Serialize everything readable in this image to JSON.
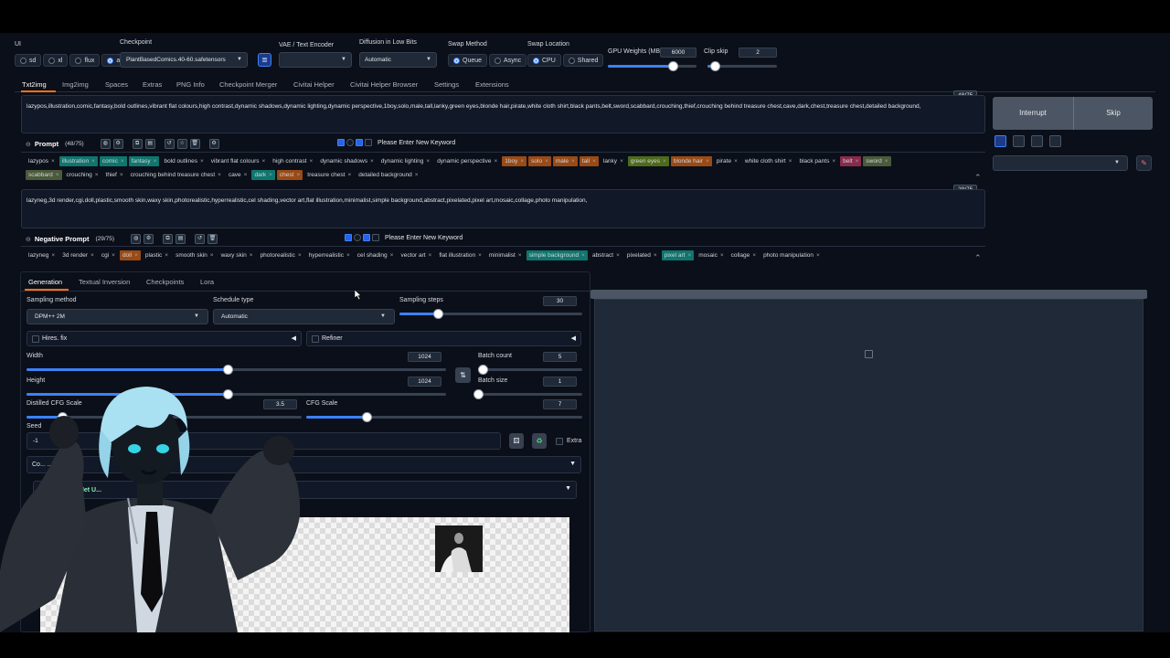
{
  "top": {
    "ui_label": "UI",
    "ui_options": [
      "sd",
      "xl",
      "flux",
      "all"
    ],
    "checkpoint_label": "Checkpoint",
    "checkpoint_value": "PlantBasedComics.40-60.safetensors",
    "vae_label": "VAE / Text Encoder",
    "vae_value": "",
    "lowbits_label": "Diffusion in Low Bits",
    "lowbits_value": "Automatic",
    "swap_method_label": "Swap Method",
    "swap_method_options": [
      "Queue",
      "Async"
    ],
    "swap_location_label": "Swap Location",
    "swap_location_options": [
      "CPU",
      "Shared"
    ],
    "gpu_weights_label": "GPU Weights (MB)",
    "gpu_weights_value": "6000",
    "gpu_weights_fraction": 0.73,
    "clip_skip_label": "Clip skip",
    "clip_skip_value": "2",
    "clip_skip_fraction": 0.1
  },
  "tabs": [
    "Txt2img",
    "Img2img",
    "Spaces",
    "Extras",
    "PNG Info",
    "Checkpoint Merger",
    "Civitai Helper",
    "Civitai Helper Browser",
    "Settings",
    "Extensions"
  ],
  "prompt": {
    "counter": "48/75",
    "text": "lazypos,illustration,comic,fantasy,bold outlines,vibrant flat colours,high contrast,dynamic shadows,dynamic lighting,dynamic perspective,1boy,solo,male,tall,lanky,green eyes,blonde hair,pirate,white cloth shirt,black pants,belt,sword,scabbard,crouching,thief,crouching behind treasure chest,cave,dark,chest,treasure chest,detailed background,",
    "label": "Prompt",
    "label_count": "(48/75)",
    "keyword_placeholder": "Please Enter New Keyword",
    "tags_row1": [
      {
        "t": "lazypos",
        "c": ""
      },
      {
        "t": "illustration",
        "c": "#0f766e"
      },
      {
        "t": "comic",
        "c": "#0f766e"
      },
      {
        "t": "fantasy",
        "c": "#0f766e"
      },
      {
        "t": "bold outlines",
        "c": ""
      },
      {
        "t": "vibrant flat colours",
        "c": ""
      },
      {
        "t": "high contrast",
        "c": ""
      },
      {
        "t": "dynamic shadows",
        "c": ""
      },
      {
        "t": "dynamic lighting",
        "c": ""
      },
      {
        "t": "dynamic perspective",
        "c": ""
      },
      {
        "t": "1boy",
        "c": "#9a4a15"
      },
      {
        "t": "solo",
        "c": "#9a4a15"
      },
      {
        "t": "male",
        "c": "#9a4a15"
      },
      {
        "t": "tall",
        "c": "#9a4a15"
      },
      {
        "t": "lanky",
        "c": ""
      },
      {
        "t": "green eyes",
        "c": "#4d6b1a"
      },
      {
        "t": "blonde hair",
        "c": "#9a4a15"
      },
      {
        "t": "pirate",
        "c": ""
      },
      {
        "t": "white cloth shirt",
        "c": ""
      },
      {
        "t": "black pants",
        "c": ""
      },
      {
        "t": "belt",
        "c": "#8a2a4a"
      },
      {
        "t": "sword",
        "c": "#4a5a3a"
      }
    ],
    "tags_row2": [
      {
        "t": "scabbard",
        "c": "#4a5a3a"
      },
      {
        "t": "crouching",
        "c": ""
      },
      {
        "t": "thief",
        "c": ""
      },
      {
        "t": "crouching behind treasure chest",
        "c": ""
      },
      {
        "t": "cave",
        "c": ""
      },
      {
        "t": "dark",
        "c": "#0f766e"
      },
      {
        "t": "chest",
        "c": "#9a4a15"
      },
      {
        "t": "treasure chest",
        "c": ""
      },
      {
        "t": "detailed background",
        "c": ""
      }
    ]
  },
  "negative": {
    "counter": "29/75",
    "text": "lazyneg,3d render,cgi,doll,plastic,smooth skin,waxy skin,photorealistic,hyperrealistic,cel shading,vector art,flat illustration,minimalist,simple background,abstract,pixelated,pixel art,mosaic,collage,photo manipulation,",
    "label": "Negative Prompt",
    "label_count": "(29/75)",
    "keyword_placeholder": "Please Enter New Keyword",
    "tags": [
      {
        "t": "lazyneg",
        "c": ""
      },
      {
        "t": "3d render",
        "c": ""
      },
      {
        "t": "cgi",
        "c": ""
      },
      {
        "t": "doll",
        "c": "#9a4a15"
      },
      {
        "t": "plastic",
        "c": ""
      },
      {
        "t": "smooth skin",
        "c": ""
      },
      {
        "t": "waxy skin",
        "c": ""
      },
      {
        "t": "photorealistic",
        "c": ""
      },
      {
        "t": "hyperrealistic",
        "c": ""
      },
      {
        "t": "cel shading",
        "c": ""
      },
      {
        "t": "vector art",
        "c": ""
      },
      {
        "t": "flat illustration",
        "c": ""
      },
      {
        "t": "minimalist",
        "c": ""
      },
      {
        "t": "simple background",
        "c": "#0f766e"
      },
      {
        "t": "abstract",
        "c": ""
      },
      {
        "t": "pixelated",
        "c": ""
      },
      {
        "t": "pixel art",
        "c": "#0f766e"
      },
      {
        "t": "mosaic",
        "c": ""
      },
      {
        "t": "collage",
        "c": ""
      },
      {
        "t": "photo manipulation",
        "c": ""
      }
    ]
  },
  "actions": {
    "interrupt": "Interrupt",
    "skip": "Skip"
  },
  "subtabs": [
    "Generation",
    "Textual Inversion",
    "Checkpoints",
    "Lora"
  ],
  "gen": {
    "sampling_method_label": "Sampling method",
    "sampling_method_value": "DPM++ 2M",
    "schedule_type_label": "Schedule type",
    "schedule_type_value": "Automatic",
    "sampling_steps_label": "Sampling steps",
    "sampling_steps_value": "30",
    "sampling_steps_fraction": 0.21,
    "hires_label": "Hires. fix",
    "refiner_label": "Refiner",
    "width_label": "Width",
    "width_value": "1024",
    "width_fraction": 0.48,
    "height_label": "Height",
    "height_value": "1024",
    "height_fraction": 0.48,
    "batch_count_label": "Batch count",
    "batch_count_value": "5",
    "batch_count_fraction": 0.04,
    "batch_size_label": "Batch size",
    "batch_size_value": "1",
    "batch_size_fraction": 0.0,
    "distilled_cfg_label": "Distilled CFG Scale",
    "distilled_cfg_value": "3.5",
    "distilled_cfg_fraction": 0.13,
    "cfg_label": "CFG Scale",
    "cfg_value": "7",
    "cfg_fraction": 0.22,
    "seed_label": "Seed",
    "seed_value": "-1",
    "extra_label": "Extra",
    "accordion_label": "Co... ...rated",
    "controlnet_label": "...Net U..."
  }
}
